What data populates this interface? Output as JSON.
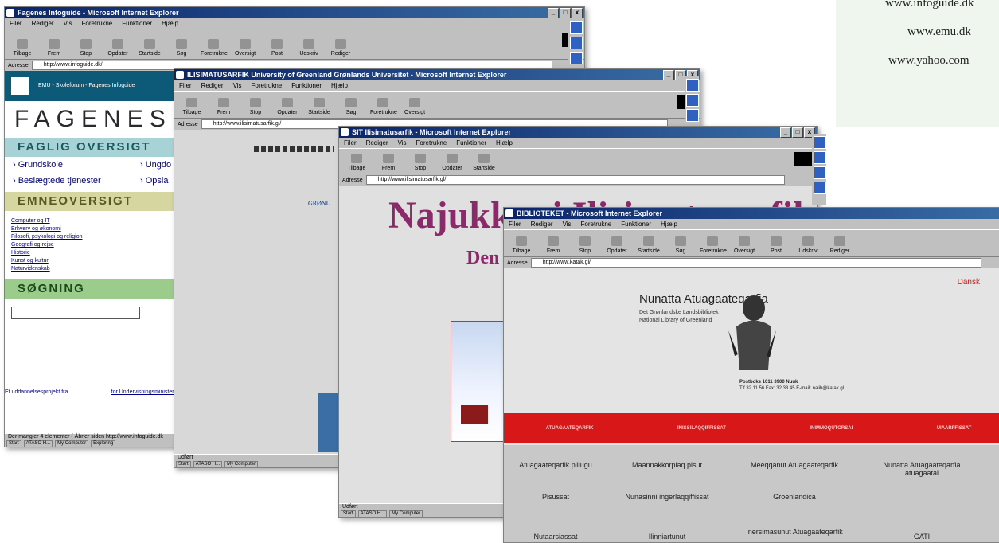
{
  "urls": [
    "www.infoguide.dk",
    "www.emu.dk",
    "www.yahoo.com"
  ],
  "menu": [
    "Filer",
    "Rediger",
    "Vis",
    "Foretrukne",
    "Funktioner",
    "Hjælp"
  ],
  "toolbar": [
    "Tilbage",
    "Frem",
    "Stop",
    "Opdater",
    "Startside",
    "Søg",
    "Foretrukne",
    "Oversigt",
    "Post",
    "Udskriv",
    "Rediger"
  ],
  "windows": {
    "w1": {
      "title": "Fagenes Infoguide - Microsoft Internet Explorer",
      "address": "http://www.infoguide.dk/",
      "banner": "EMU - Skoleforum - Fagenes Infoguide",
      "brand": "FAGENES",
      "sec1": "FAGLIG OVERSIGT",
      "links": [
        "› Grundskole",
        "› Ungdo",
        "› Beslægtede tjenester",
        "› Opsla"
      ],
      "sec2": "EMNEOVERSIGT",
      "topics": [
        "Computer og IT",
        "Erhverv og økonomi",
        "Filosofi, psykologi og religion",
        "Geografi og rejse",
        "Historie",
        "Kunst og kultur",
        "Naturvidenskab"
      ],
      "sec3": "SØGNING",
      "footer_left": "Et uddannelsesprojekt fra",
      "footer_right": "for Undervisningsministeriet",
      "status": "Der mangler 4 elementer ( Åbner siden http://www.infoguide.dk"
    },
    "w2": {
      "title": "ILISIMATUSARFIK University of Greenland Grønlands Universitet - Microsoft Internet Explorer",
      "address": "http://www.ilisimatusarfik.gl/",
      "side": "GRØNL",
      "status": "Udført"
    },
    "w3": {
      "title": "SIT Ilisimatusarfik - Microsoft Internet Explorer",
      "address": "http://www.ilisimatusarfik.gl/",
      "heading": "Najukkani Ilisimatusarfik",
      "sub": "Den",
      "status": "Udført"
    },
    "w4": {
      "title": "BIBLIOTEKET - Microsoft Internet Explorer",
      "address": "http://www.katak.gl/",
      "lang": "Dansk",
      "name": "Nunatta Atuagaateqarfia",
      "sub1": "Det Grønlandske Landsbibliotek",
      "sub2": "National Library of Greenland",
      "contact1": "Postboks 1011 3900 Nuuk",
      "contact2": "Tlf.32 11 56 Fax: 32 38 45 E-mail: nalib@katak.gl",
      "red": [
        "ATUAGAATEQARFIK",
        "INISSILAQQIFFISSAT",
        "INIMMOQUTORSAI",
        "UIAARFFISSAT"
      ],
      "cells": [
        "Atuagaateqarfik pillugu",
        "Maannakkorpiaq pisut",
        "Meeqqanut Atuagaateqarfik",
        "Nunatta Atuagaateqarfia atuagaatai",
        "Pisussat",
        "Nunasinni ingerlaqqiffissat",
        "Groenlandica",
        "Nutaarsiassat",
        "Ilinniartunut",
        "Inersimasunut Atuagaateqarfik",
        "GATI"
      ]
    }
  },
  "taskbar": [
    "Start",
    "ATASO H...",
    "My Computer",
    "Exploring"
  ]
}
